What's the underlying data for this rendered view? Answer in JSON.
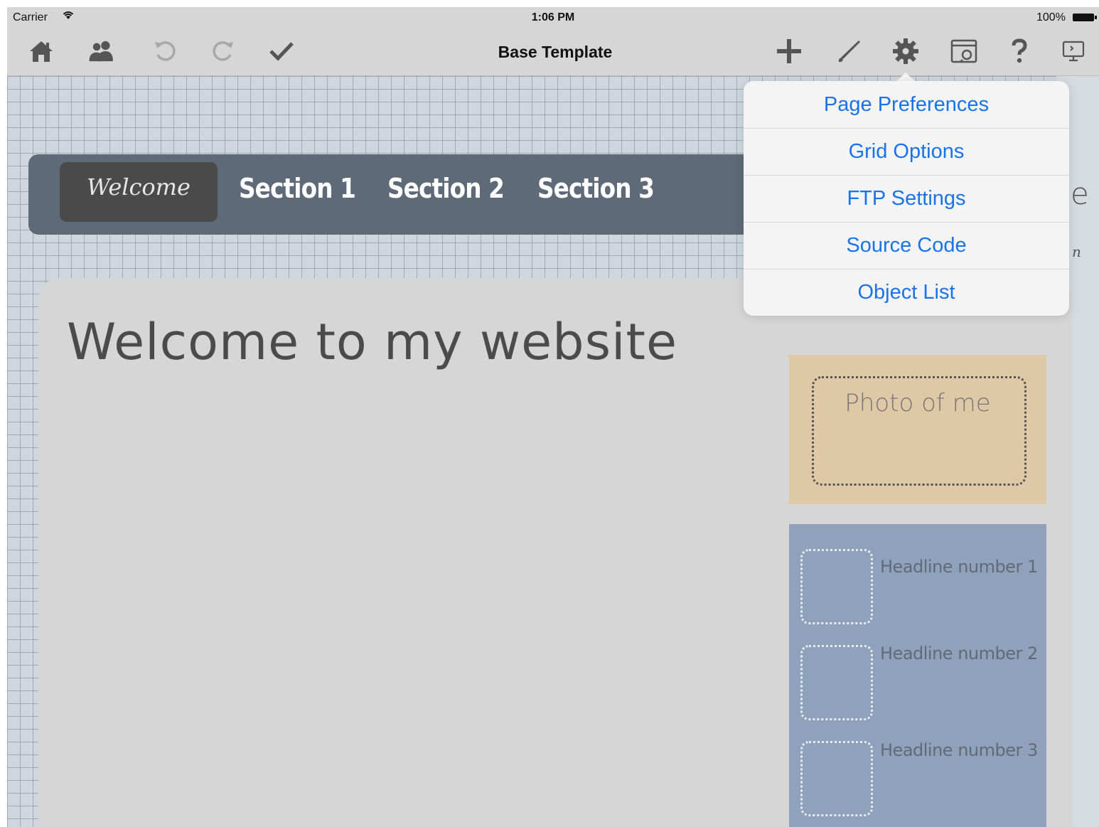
{
  "status_bar": {
    "carrier": "Carrier",
    "time": "1:06 PM",
    "battery": "100%"
  },
  "toolbar": {
    "title": "Base Template",
    "left_icons": [
      "home-icon",
      "users-icon",
      "undo-icon",
      "redo-icon",
      "checkmark-icon"
    ],
    "right_icons": [
      "plus-icon",
      "brush-icon",
      "gear-icon",
      "browser-preview-icon",
      "help-icon",
      "monitor-icon"
    ]
  },
  "popover_menu": {
    "items": [
      "Page Preferences",
      "Grid Options",
      "FTP Settings",
      "Source Code",
      "Object List"
    ]
  },
  "page": {
    "nav": {
      "welcome": "Welcome",
      "items": [
        "Section 1",
        "Section 2",
        "Section 3"
      ]
    },
    "heading": "Welcome to my website",
    "photo_label": "Photo of me",
    "headlines": [
      "Headline number 1",
      "Headline number 2",
      "Headline number 3"
    ],
    "decorative_e": "e",
    "decorative_n": "n"
  },
  "colors": {
    "accent": "#1a73e8",
    "nav_bar": "#5f6a78",
    "photo_box": "#dfc8a6",
    "headlines_box": "#90a2bb"
  }
}
